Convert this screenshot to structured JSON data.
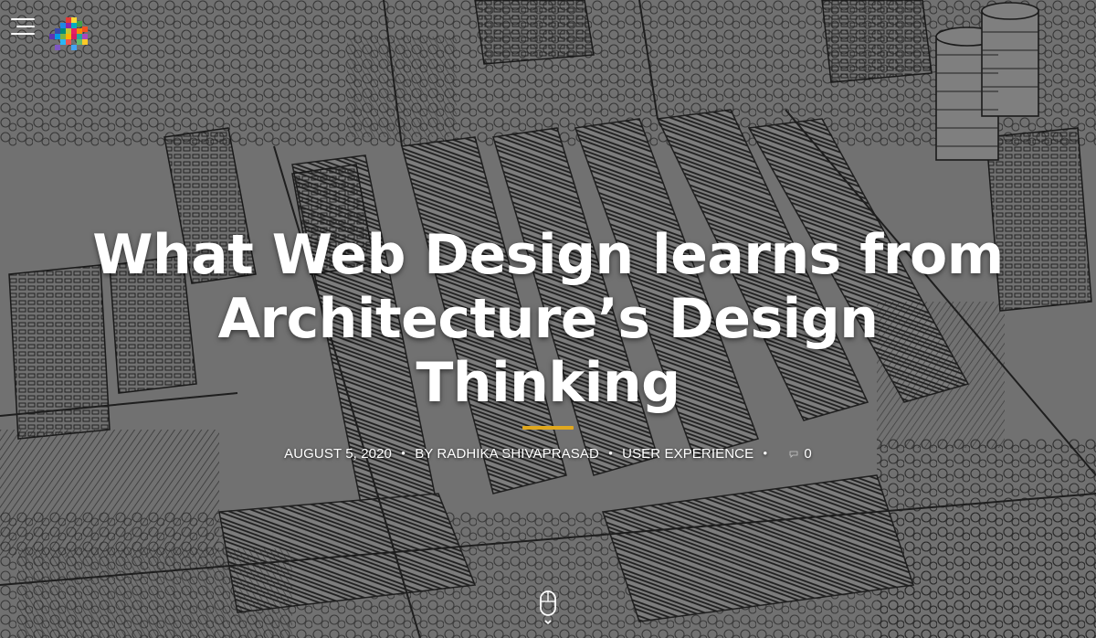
{
  "header": {
    "menu_icon": "hamburger-menu-icon",
    "logo_icon": "colorful-pixel-logo-icon"
  },
  "post": {
    "title_line1": "What Web Design learns from",
    "title_line2": "Architecture’s Design Thinking",
    "date": "AUGUST 5, 2020",
    "author": "BY RADHIKA SHIVAPRASAD",
    "category": "USER EXPERIENCE",
    "comments_count": "0",
    "separator": "•"
  },
  "scroll_indicator": {
    "icon": "mouse-scroll-down-icon"
  },
  "colors": {
    "accent_underline": "#e0a81f",
    "title_text": "#ffffff",
    "background": "#6e6e6e"
  }
}
